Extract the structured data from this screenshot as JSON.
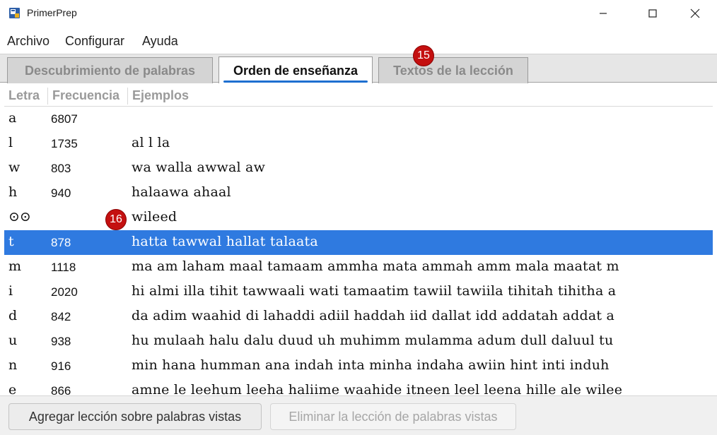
{
  "window": {
    "title": "PrimerPrep"
  },
  "menu": {
    "items": [
      "Archivo",
      "Configurar",
      "Ayuda"
    ]
  },
  "tabs": [
    {
      "label": "Descubrimiento de palabras",
      "active": false
    },
    {
      "label": "Orden de enseñanza",
      "active": true
    },
    {
      "label": "Textos de la lección",
      "active": false
    }
  ],
  "badges": {
    "tab_badge": "15",
    "row_badge": "16"
  },
  "table": {
    "columns": [
      "Letra",
      "Frecuencia",
      "Ejemplos"
    ],
    "rows": [
      {
        "letter": "a",
        "freq": "6807",
        "examples": "",
        "selected": false
      },
      {
        "letter": "l",
        "freq": "1735",
        "examples": "al  l  la",
        "selected": false
      },
      {
        "letter": "w",
        "freq": "803",
        "examples": "wa  walla  awwal  aw",
        "selected": false
      },
      {
        "letter": "h",
        "freq": "940",
        "examples": "halaawa  ahaal",
        "selected": false
      },
      {
        "letter": "⊙⊙",
        "freq": "",
        "examples": "wileed",
        "selected": false
      },
      {
        "letter": "t",
        "freq": "878",
        "examples": "hatta  tawwal  hallat  talaata",
        "selected": true
      },
      {
        "letter": "m",
        "freq": "1118",
        "examples": "ma  am  laham  maal  tamaam  ammha  mata  ammah  amm  mala  maatat  m",
        "selected": false
      },
      {
        "letter": "i",
        "freq": "2020",
        "examples": "hi  almi  illa  tihit  tawwaali  wati  tamaatim  tawiil  tawiila  tihitah  tihitha  a",
        "selected": false
      },
      {
        "letter": "d",
        "freq": "842",
        "examples": "da  adim  waahid  di  lahaddi  adiil  haddah  iid  dallat  idd  addatah  addat  a",
        "selected": false
      },
      {
        "letter": "u",
        "freq": "938",
        "examples": "hu  mulaah  halu  dalu  duud  uh  muhimm  mulamma  adum  dull  daluul  tu",
        "selected": false
      },
      {
        "letter": "n",
        "freq": "916",
        "examples": "min  hana  humman  ana  indah  inta  minha  indaha  awiin  hint  inti  induh",
        "selected": false
      },
      {
        "letter": "e",
        "freq": "866",
        "examples": "amne  le  leehum  leeha  haliime  waahide  itneen  leel  leena  hille  ale  wilee",
        "selected": false
      }
    ]
  },
  "buttons": {
    "add": {
      "label": "Agregar lección sobre palabras vistas",
      "enabled": true
    },
    "remove": {
      "label": "Eliminar la lección de palabras vistas",
      "enabled": false
    }
  },
  "colors": {
    "selection": "#2f7ae0",
    "badge": "#c41010",
    "tab_underline": "#1e6fd0"
  },
  "icons": {
    "app": "primerprep-app-icon",
    "minimize": "minimize-icon",
    "maximize": "maximize-icon",
    "close": "close-icon"
  }
}
